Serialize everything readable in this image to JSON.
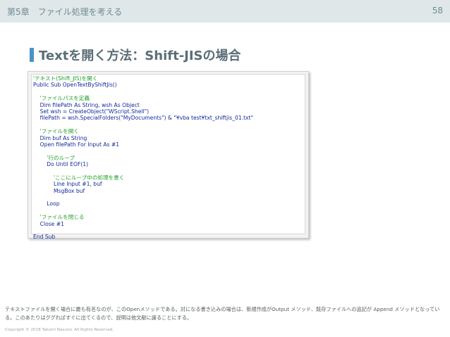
{
  "header": {
    "chapter": "第5章　ファイル処理を考える",
    "page_number": "58"
  },
  "slide": {
    "title": "Textを開く方法：Shift-JISの場合"
  },
  "code": {
    "lines": [
      {
        "text": "'テキスト(Shift_JIS)を開く",
        "kind": "c"
      },
      {
        "text": "Public Sub OpenTextByShiftJis()",
        "kind": "k"
      },
      {
        "text": "",
        "kind": "k"
      },
      {
        "text": "    'ファイルパスを定義",
        "kind": "c"
      },
      {
        "text": "    Dim filePath As String, wsh As Object",
        "kind": "k"
      },
      {
        "text": "    Set wsh = CreateObject(\"WScript.Shell\")",
        "kind": "k"
      },
      {
        "text": "    filePath = wsh.SpecialFolders(\"MyDocuments\") & \"¥vba test¥txt_shiftjis_01.txt\"",
        "kind": "k"
      },
      {
        "text": "",
        "kind": "k"
      },
      {
        "text": "    'ファイルを開く",
        "kind": "c"
      },
      {
        "text": "    Dim buf As String",
        "kind": "k"
      },
      {
        "text": "    Open filePath For Input As #1",
        "kind": "k"
      },
      {
        "text": "",
        "kind": "k"
      },
      {
        "text": "        '行のループ",
        "kind": "c"
      },
      {
        "text": "        Do Until EOF(1)",
        "kind": "k"
      },
      {
        "text": "",
        "kind": "k"
      },
      {
        "text": "            'ここにループ中の処理を書く",
        "kind": "c"
      },
      {
        "text": "            Line Input #1, buf",
        "kind": "k"
      },
      {
        "text": "            MsgBox buf",
        "kind": "k"
      },
      {
        "text": "",
        "kind": "k"
      },
      {
        "text": "        Loop",
        "kind": "k"
      },
      {
        "text": "",
        "kind": "k"
      },
      {
        "text": "    'ファイルを閉じる",
        "kind": "c"
      },
      {
        "text": "    Close #1",
        "kind": "k"
      },
      {
        "text": "",
        "kind": "k"
      },
      {
        "text": "End Sub",
        "kind": "k"
      }
    ]
  },
  "footer": {
    "description": "テキストファイルを開く場合に最も有名なのが、このOpenメソッドである。対になる書き込みの場合は、新規作成がOutput メソッド、既存ファイルへの追記が Append メソッドとなっている。このあたりはググればすぐに出てくるので、説明は他文献に譲ることにする。",
    "copyright": "Copyright © 2018 Takumi Nasuno. All Rights Reserved."
  },
  "colors": {
    "header_bg": "#dfe7e9",
    "accent": "#4a92c8",
    "comment": "#22a02a",
    "keyword": "#142a9a"
  }
}
